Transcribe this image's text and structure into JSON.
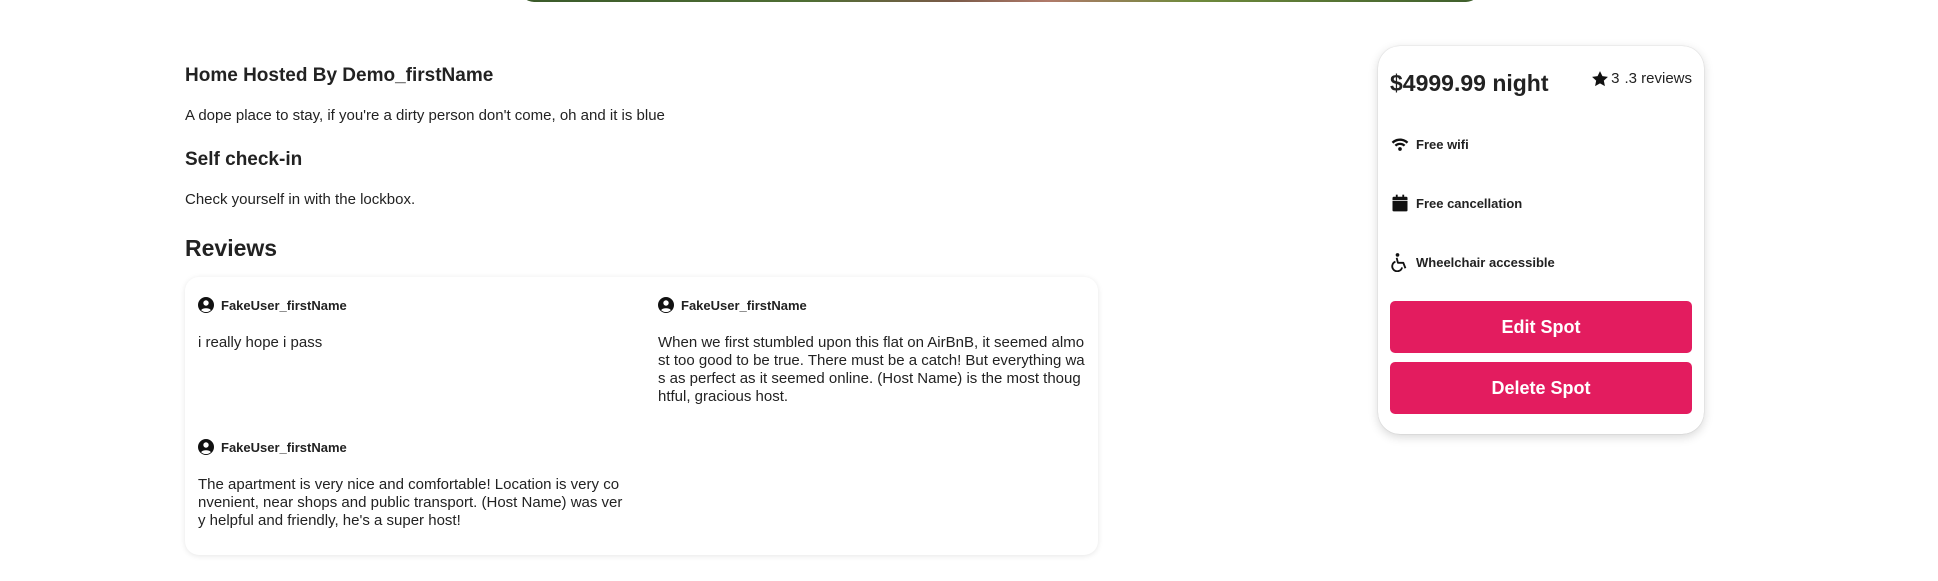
{
  "host": {
    "title": "Home Hosted By Demo_firstName",
    "description": "A dope place to stay, if you're a dirty person don't come, oh and it is blue"
  },
  "checkin": {
    "title": "Self check-in",
    "text": "Check yourself in with the lockbox."
  },
  "reviews": {
    "heading": "Reviews",
    "items": [
      {
        "user": "FakeUser_firstName",
        "text": "i really hope i pass"
      },
      {
        "user": "FakeUser_firstName",
        "text": "When we first stumbled upon this flat on AirBnB, it seemed almost too good to be true. There must be a catch! But everything was as perfect as it seemed online. (Host Name) is the most thoughtful, gracious host."
      },
      {
        "user": "FakeUser_firstName",
        "text": "The apartment is very nice and comfortable! Location is very convenient, near shops and public transport. (Host Name) was very helpful and friendly, he's a super host!"
      }
    ]
  },
  "booking": {
    "price": "$4999.99 night",
    "rating": "3",
    "reviews_count": ".3 reviews",
    "amenities": [
      {
        "icon": "wifi-icon",
        "label": "Free wifi"
      },
      {
        "icon": "calendar-icon",
        "label": "Free cancellation"
      },
      {
        "icon": "wheelchair-icon",
        "label": "Wheelchair accessible"
      }
    ],
    "edit_label": "Edit Spot",
    "delete_label": "Delete Spot"
  },
  "colors": {
    "accent": "#e31c5f",
    "text": "#222222"
  }
}
